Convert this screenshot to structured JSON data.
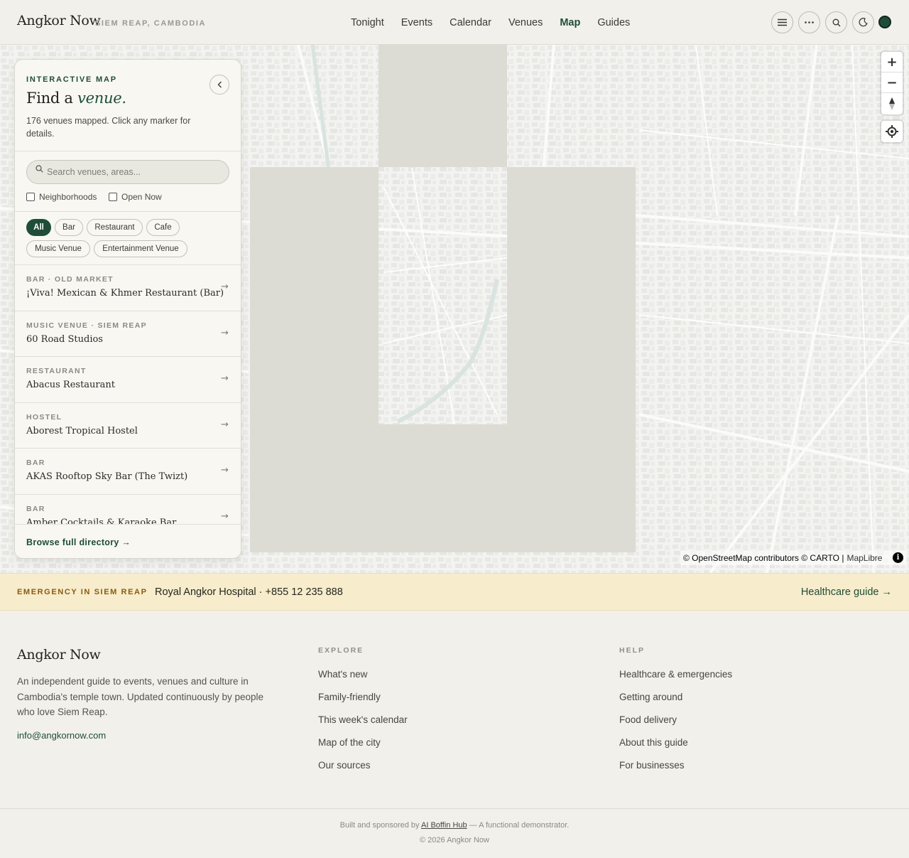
{
  "header": {
    "brand": "Angkor Now",
    "location": "SIEM REAP, CAMBODIA",
    "nav": [
      {
        "label": "Tonight"
      },
      {
        "label": "Events"
      },
      {
        "label": "Calendar"
      },
      {
        "label": "Venues"
      },
      {
        "label": "Map",
        "active": true
      },
      {
        "label": "Guides"
      }
    ],
    "icons": [
      "menu-icon",
      "more-icon",
      "search-icon",
      "moon-icon",
      "theme-dot"
    ],
    "accent": "#1f4d38"
  },
  "panel": {
    "kicker": "INTERACTIVE MAP",
    "title_plain": "Find a",
    "title_em": "venue.",
    "description": "176 venues mapped. Click any marker for details.",
    "search_placeholder": "Search venues, areas...",
    "checkboxes": [
      {
        "label": "Neighborhoods",
        "checked": false
      },
      {
        "label": "Open Now",
        "checked": false
      }
    ],
    "filters": [
      {
        "label": "All",
        "active": true
      },
      {
        "label": "Bar"
      },
      {
        "label": "Restaurant"
      },
      {
        "label": "Cafe"
      },
      {
        "label": "Music Venue"
      },
      {
        "label": "Entertainment Venue"
      }
    ],
    "venues": [
      {
        "meta": "BAR · OLD MARKET",
        "name": "¡Viva! Mexican & Khmer Restaurant (Bar)"
      },
      {
        "meta": "MUSIC VENUE · SIEM REAP",
        "name": "60 Road Studios"
      },
      {
        "meta": "RESTAURANT",
        "name": "Abacus Restaurant"
      },
      {
        "meta": "HOSTEL",
        "name": "Aborest Tropical Hostel"
      },
      {
        "meta": "BAR",
        "name": "AKAS Rooftop Sky Bar (The Twizt)"
      },
      {
        "meta": "BAR",
        "name": "Amber Cocktails & Karaoke Bar"
      }
    ],
    "footer_link": "Browse full directory →"
  },
  "map": {
    "controls": [
      "zoom-in",
      "zoom-out",
      "compass"
    ],
    "attribution": "© OpenStreetMap contributors © CARTO |",
    "attribution_link": "MapLibre"
  },
  "emergency": {
    "label": "EMERGENCY IN SIEM REAP",
    "text": "Royal Angkor Hospital · +855 12 235 888",
    "link": "Healthcare guide →",
    "bg": "#f7eccb"
  },
  "footer": {
    "brand": "Angkor Now",
    "description": "An independent guide to events, venues and culture in Cambodia's temple town. Updated continuously by people who love Siem Reap.",
    "email": "info@angkornow.com",
    "explore_heading": "EXPLORE",
    "explore": [
      "What's new",
      "Family-friendly",
      "This week's calendar",
      "Map of the city",
      "Our sources"
    ],
    "help_heading": "HELP",
    "help": [
      "Healthcare & emergencies",
      "Getting around",
      "Food delivery",
      "About this guide",
      "For businesses"
    ],
    "built_prefix": "Built and sponsored by",
    "built_link": "AI Boffin Hub",
    "built_suffix": "— A functional demonstrator.",
    "copyright": "© 2026 Angkor Now"
  }
}
